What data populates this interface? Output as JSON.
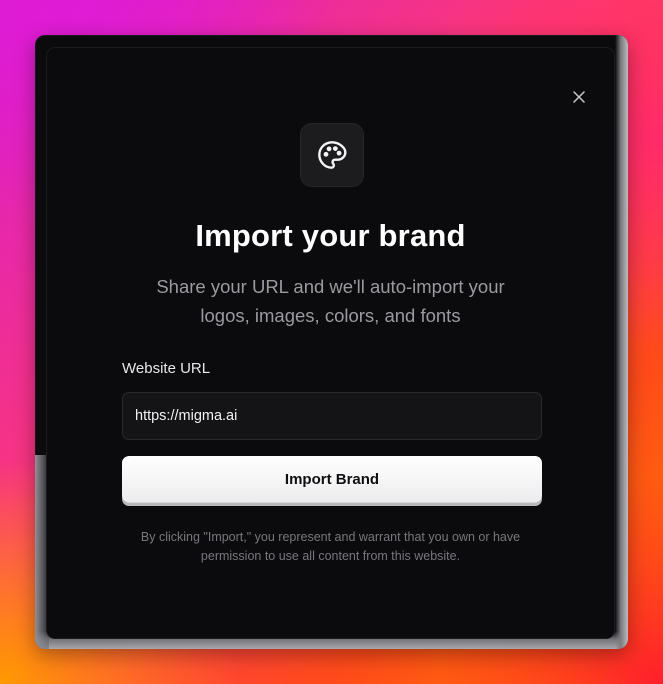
{
  "modal": {
    "title": "Import your brand",
    "subtitle": "Share your URL and we'll auto-import your logos, images, colors, and fonts",
    "url_label": "Website URL",
    "url_value": "https://migma.ai",
    "import_label": "Import Brand",
    "disclaimer": "By clicking \"Import,\" you represent and warrant that you own or have permission to use all content from this website.",
    "icons": {
      "close": "close-icon",
      "brand": "palette-icon"
    }
  },
  "colors": {
    "modal_bg": "#0b0b0d",
    "button_bg": "#ffffff",
    "muted_text": "#9a9aa0"
  }
}
